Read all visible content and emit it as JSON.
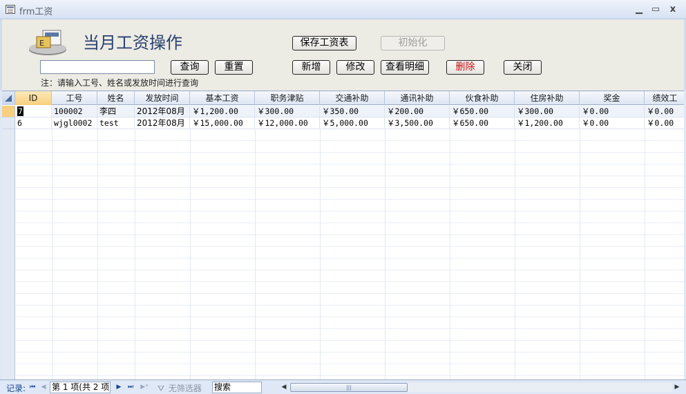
{
  "window": {
    "title": "frm工资",
    "minimize": "▁",
    "maximize": "▭",
    "close": "x"
  },
  "header": {
    "form_title": "当月工资操作",
    "search_value": "",
    "hint": "注：请输入工号、姓名或发放时间进行查询",
    "buttons": {
      "save_sheet": "保存工资表",
      "initialize": "初始化",
      "query": "查询",
      "reset": "重置",
      "add": "新增",
      "edit": "修改",
      "view_detail": "查看明细",
      "delete": "删除",
      "close": "关闭"
    },
    "logo_text": "E"
  },
  "grid": {
    "columns": [
      "ID",
      "工号",
      "姓名",
      "发放时间",
      "基本工资",
      "职务津贴",
      "交通补助",
      "通讯补助",
      "伙食补助",
      "住房补助",
      "奖金",
      "绩效工"
    ],
    "rows": [
      [
        "7",
        "100002",
        "李四",
        "2012年08月",
        "￥1,200.00",
        "￥300.00",
        "￥350.00",
        "￥200.00",
        "￥650.00",
        "￥300.00",
        "￥0.00",
        "￥0.00"
      ],
      [
        "6",
        "wjgl0002",
        "test",
        "2012年08月",
        "￥15,000.00",
        "￥12,000.00",
        "￥5,000.00",
        "￥3,500.00",
        "￥650.00",
        "￥1,200.00",
        "￥0.00",
        "￥0.00"
      ]
    ]
  },
  "navigation": {
    "label": "记录:",
    "first": "⏮",
    "prev": "◀",
    "next": "▶",
    "last": "⏭",
    "new": "▶*",
    "record_text": "第 1 项(共 2 项)",
    "filter_text": "无筛选器",
    "search_text": "搜索",
    "scroll_left": "◀",
    "scroll_right": "▶",
    "scroll_grip": "|||"
  }
}
